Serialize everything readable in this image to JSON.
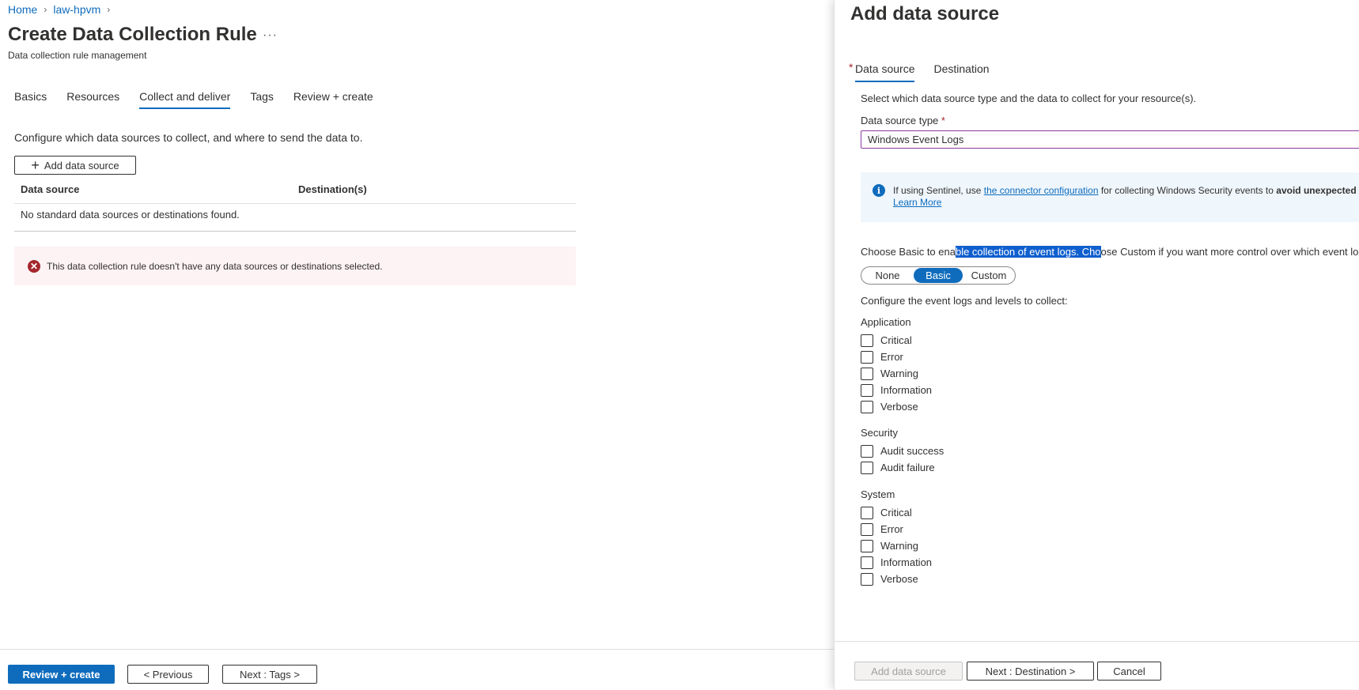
{
  "breadcrumb": [
    {
      "label": "Home"
    },
    {
      "label": "law-hpvm"
    }
  ],
  "page": {
    "title": "Create Data Collection Rule",
    "more": "···",
    "subtitle": "Data collection rule management"
  },
  "tabs": [
    "Basics",
    "Resources",
    "Collect and deliver",
    "Tags",
    "Review + create"
  ],
  "active_tab": "Collect and deliver",
  "collect": {
    "intro": "Configure which data sources to collect, and where to send the data to.",
    "add_button": "Add data source",
    "grid_headers": [
      "Data source",
      "Destination(s)"
    ],
    "empty_message": "No standard data sources or destinations found.",
    "error_message": "This data collection rule doesn't have any data sources or destinations selected."
  },
  "footer": {
    "review_create": "Review + create",
    "previous": "< Previous",
    "next": "Next : Tags >"
  },
  "panel": {
    "title": "Add data source",
    "tabs": [
      "Data source",
      "Destination"
    ],
    "active_tab": "Data source",
    "description": "Select which data source type and the data to collect for your resource(s).",
    "data_source_type_label": "Data source type",
    "required_mark": "*",
    "data_source_type_value": "Windows Event Logs",
    "info": {
      "prefix": "If using Sentinel, use ",
      "link": "the connector configuration",
      "middle": " for collecting Windows Security events to ",
      "bold": "avoid unexpected",
      "learn_more": "Learn More"
    },
    "choose": {
      "part1": "Choose Basic to ena",
      "highlighted": "ble collection of event logs. Cho",
      "part2": "ose Custom if you want more control over which event log"
    },
    "toggle_options": [
      "None",
      "Basic",
      "Custom"
    ],
    "toggle_selected": "Basic",
    "configure_label": "Configure the event logs and levels to collect:",
    "groups": [
      {
        "title": "Application",
        "items": [
          "Critical",
          "Error",
          "Warning",
          "Information",
          "Verbose"
        ]
      },
      {
        "title": "Security",
        "items": [
          "Audit success",
          "Audit failure"
        ]
      },
      {
        "title": "System",
        "items": [
          "Critical",
          "Error",
          "Warning",
          "Information",
          "Verbose"
        ]
      }
    ],
    "footer": {
      "add": "Add data source",
      "next": "Next : Destination >",
      "cancel": "Cancel"
    }
  },
  "colors": {
    "accent": "#0f6cbd",
    "error": "#a4262c",
    "error_bg": "#fdf3f4",
    "info_bg": "#eff6fc"
  }
}
